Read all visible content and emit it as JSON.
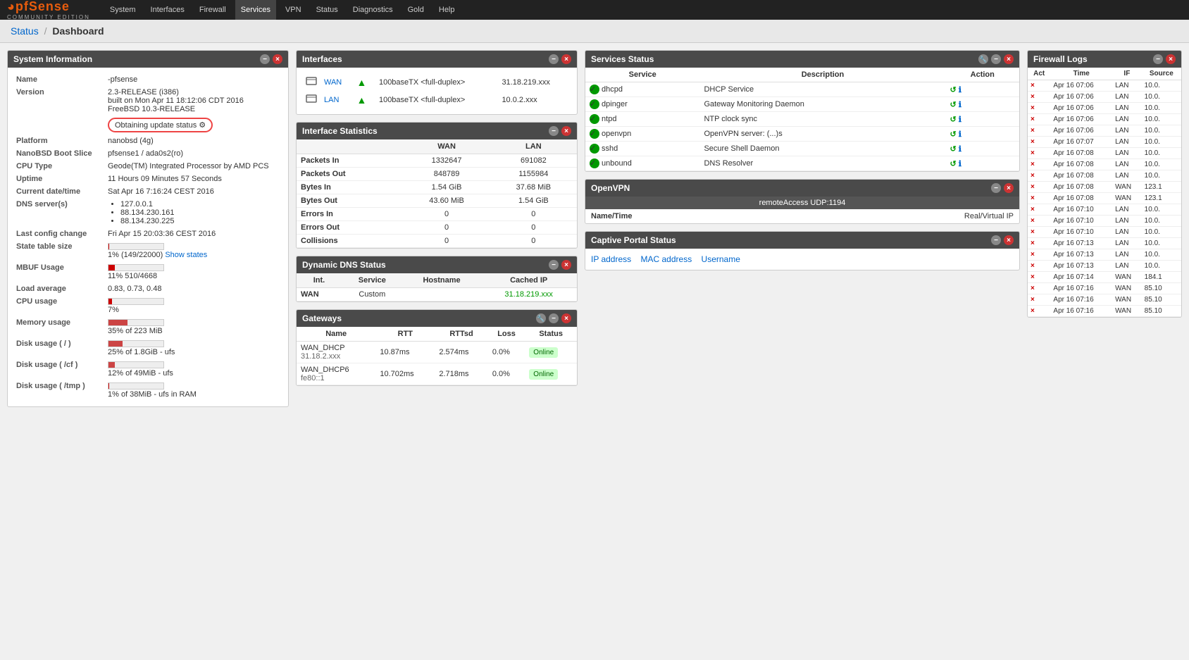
{
  "navbar": {
    "brand": "pfSense",
    "community": "COMMUNITY EDITION",
    "items": [
      {
        "label": "System",
        "active": false
      },
      {
        "label": "Interfaces",
        "active": false
      },
      {
        "label": "Firewall",
        "active": false
      },
      {
        "label": "Services",
        "active": true
      },
      {
        "label": "VPN",
        "active": false
      },
      {
        "label": "Status",
        "active": false
      },
      {
        "label": "Diagnostics",
        "active": false
      },
      {
        "label": "Gold",
        "active": false
      },
      {
        "label": "Help",
        "active": false
      }
    ]
  },
  "breadcrumb": {
    "parent": "Status",
    "current": "Dashboard"
  },
  "system_info": {
    "title": "System Information",
    "rows": [
      {
        "label": "Name",
        "value": "-pfsense"
      },
      {
        "label": "Version",
        "value": "2.3-RELEASE (i386)\nbuilt on Mon Apr 11 18:12:06 CDT 2016\nFreeBSD 10.3-RELEASE"
      },
      {
        "label": "Update",
        "value": "Obtaining update status"
      },
      {
        "label": "Platform",
        "value": "nanobsd (4g)"
      },
      {
        "label": "NanoBSD Boot Slice",
        "value": "pfsense1 / ada0s2(ro)"
      },
      {
        "label": "CPU Type",
        "value": "Geode(TM) Integrated Processor by AMD PCS"
      },
      {
        "label": "Uptime",
        "value": "11 Hours 09 Minutes 57 Seconds"
      },
      {
        "label": "Current date/time",
        "value": "Sat Apr 16 7:16:24 CEST 2016"
      },
      {
        "label": "DNS server(s)",
        "values": [
          "127.0.0.1",
          "88.134.230.161",
          "88.134.230.225"
        ]
      },
      {
        "label": "Last config change",
        "value": "Fri Apr 15 20:03:36 CEST 2016"
      },
      {
        "label": "State table size",
        "value": "1% (149/22000)",
        "link": "Show states",
        "bar_pct": 1,
        "bar_color": "#c00"
      },
      {
        "label": "MBUF Usage",
        "value": "11% 510/4668",
        "bar_pct": 11,
        "bar_color": "#c00"
      },
      {
        "label": "Load average",
        "value": "0.83, 0.73, 0.48"
      },
      {
        "label": "CPU usage",
        "value": "7%",
        "bar_pct": 7,
        "bar_color": "#c00"
      },
      {
        "label": "Memory usage",
        "value": "35% of 223 MiB",
        "bar_pct": 35,
        "bar_color": "#c44"
      },
      {
        "label": "Disk usage ( / )",
        "value": "25% of 1.8GiB - ufs",
        "bar_pct": 25,
        "bar_color": "#c44"
      },
      {
        "label": "Disk usage ( /cf )",
        "value": "12% of 49MiB - ufs",
        "bar_pct": 12,
        "bar_color": "#c44"
      },
      {
        "label": "Disk usage ( /tmp )",
        "value": "1% of 38MiB - ufs in RAM",
        "bar_pct": 1,
        "bar_color": "#c00"
      }
    ]
  },
  "interfaces": {
    "title": "Interfaces",
    "rows": [
      {
        "name": "WAN",
        "speed": "100baseTX <full-duplex>",
        "ip": "31.18.219.xxx"
      },
      {
        "name": "LAN",
        "speed": "100baseTX <full-duplex>",
        "ip": "10.0.2.xxx"
      }
    ]
  },
  "interface_stats": {
    "title": "Interface Statistics",
    "cols": [
      "WAN",
      "LAN"
    ],
    "rows": [
      {
        "label": "Packets In",
        "wan": "1332647",
        "lan": "691082"
      },
      {
        "label": "Packets Out",
        "wan": "848789",
        "lan": "1155984"
      },
      {
        "label": "Bytes In",
        "wan": "1.54 GiB",
        "lan": "37.68 MiB"
      },
      {
        "label": "Bytes Out",
        "wan": "43.60 MiB",
        "lan": "1.54 GiB"
      },
      {
        "label": "Errors In",
        "wan": "0",
        "lan": "0"
      },
      {
        "label": "Errors Out",
        "wan": "0",
        "lan": "0"
      },
      {
        "label": "Collisions",
        "wan": "0",
        "lan": "0"
      }
    ]
  },
  "dynamic_dns": {
    "title": "Dynamic DNS Status",
    "headers": [
      "Int.",
      "Service",
      "Hostname",
      "Cached IP"
    ],
    "rows": [
      {
        "int": "WAN",
        "service": "Custom",
        "hostname": "",
        "cached_ip": "31.18.219.xxx"
      }
    ]
  },
  "gateways": {
    "title": "Gateways",
    "headers": [
      "Name",
      "RTT",
      "RTTsd",
      "Loss",
      "Status"
    ],
    "rows": [
      {
        "name": "WAN_DHCP",
        "ip": "31.18.2.xxx",
        "rtt": "10.87ms",
        "rttsd": "2.574ms",
        "loss": "0.0%",
        "status": "Online"
      },
      {
        "name": "WAN_DHCP6",
        "ip": "fe80::1",
        "rtt": "10.702ms",
        "rttsd": "2.718ms",
        "loss": "0.0%",
        "status": "Online"
      }
    ]
  },
  "services_status": {
    "title": "Services Status",
    "headers": [
      "Service",
      "Description",
      "Action"
    ],
    "rows": [
      {
        "name": "dhcpd",
        "desc": "DHCP Service",
        "status": "green"
      },
      {
        "name": "dpinger",
        "desc": "Gateway Monitoring Daemon",
        "status": "green"
      },
      {
        "name": "ntpd",
        "desc": "NTP clock sync",
        "status": "green"
      },
      {
        "name": "openvpn",
        "desc": "OpenVPN server: (...)s",
        "status": "green"
      },
      {
        "name": "sshd",
        "desc": "Secure Shell Daemon",
        "status": "green"
      },
      {
        "name": "unbound",
        "desc": "DNS Resolver",
        "status": "green"
      }
    ]
  },
  "openvpn": {
    "title": "OpenVPN",
    "instance": "remoteAccess UDP:1194",
    "headers": [
      "Name/Time",
      "Real/Virtual IP"
    ]
  },
  "captive_portal": {
    "title": "Captive Portal Status",
    "headers": [
      "IP address",
      "MAC address",
      "Username"
    ]
  },
  "firewall_logs": {
    "title": "Firewall Logs",
    "headers": [
      "Act",
      "Time",
      "IF",
      "Source"
    ],
    "rows": [
      {
        "act": "×",
        "time": "Apr 16 07:06",
        "iface": "LAN",
        "source": "10.0."
      },
      {
        "act": "×",
        "time": "Apr 16 07:06",
        "iface": "LAN",
        "source": "10.0."
      },
      {
        "act": "×",
        "time": "Apr 16 07:06",
        "iface": "LAN",
        "source": "10.0."
      },
      {
        "act": "×",
        "time": "Apr 16 07:06",
        "iface": "LAN",
        "source": "10.0."
      },
      {
        "act": "×",
        "time": "Apr 16 07:06",
        "iface": "LAN",
        "source": "10.0."
      },
      {
        "act": "×",
        "time": "Apr 16 07:07",
        "iface": "LAN",
        "source": "10.0."
      },
      {
        "act": "×",
        "time": "Apr 16 07:08",
        "iface": "LAN",
        "source": "10.0."
      },
      {
        "act": "×",
        "time": "Apr 16 07:08",
        "iface": "LAN",
        "source": "10.0."
      },
      {
        "act": "×",
        "time": "Apr 16 07:08",
        "iface": "LAN",
        "source": "10.0."
      },
      {
        "act": "×",
        "time": "Apr 16 07:08",
        "iface": "WAN",
        "source": "123.1"
      },
      {
        "act": "×",
        "time": "Apr 16 07:08",
        "iface": "WAN",
        "source": "123.1"
      },
      {
        "act": "×",
        "time": "Apr 16 07:10",
        "iface": "LAN",
        "source": "10.0."
      },
      {
        "act": "×",
        "time": "Apr 16 07:10",
        "iface": "LAN",
        "source": "10.0."
      },
      {
        "act": "×",
        "time": "Apr 16 07:10",
        "iface": "LAN",
        "source": "10.0."
      },
      {
        "act": "×",
        "time": "Apr 16 07:13",
        "iface": "LAN",
        "source": "10.0."
      },
      {
        "act": "×",
        "time": "Apr 16 07:13",
        "iface": "LAN",
        "source": "10.0."
      },
      {
        "act": "×",
        "time": "Apr 16 07:13",
        "iface": "LAN",
        "source": "10.0."
      },
      {
        "act": "×",
        "time": "Apr 16 07:14",
        "iface": "WAN",
        "source": "184.1"
      },
      {
        "act": "×",
        "time": "Apr 16 07:16",
        "iface": "WAN",
        "source": "85.10"
      },
      {
        "act": "×",
        "time": "Apr 16 07:16",
        "iface": "WAN",
        "source": "85.10"
      },
      {
        "act": "×",
        "time": "Apr 16 07:16",
        "iface": "WAN",
        "source": "85.10"
      }
    ]
  }
}
